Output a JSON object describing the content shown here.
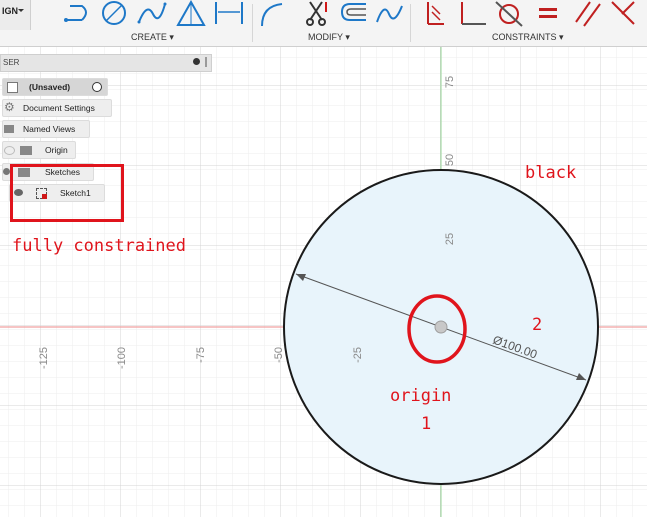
{
  "toolbar": {
    "workspace_label": "IGN",
    "groups": [
      {
        "label": "CREATE ▾"
      },
      {
        "label": "MODIFY ▾"
      },
      {
        "label": "CONSTRAINTS ▾"
      }
    ]
  },
  "browser": {
    "header_label": "SER",
    "root": "(Unsaved)",
    "items": [
      {
        "label": "Document Settings"
      },
      {
        "label": "Named Views"
      },
      {
        "label": "Origin"
      },
      {
        "label": "Sketches"
      },
      {
        "label": "Sketch1"
      }
    ]
  },
  "canvas": {
    "x_ticks": [
      "-125",
      "-100",
      "-75",
      "-50",
      "-25"
    ],
    "y_ticks": [
      "75",
      "50",
      "25"
    ],
    "dimension_label": "Ø100.00",
    "colors": {
      "axis_red": "#f0a0a0",
      "axis_green": "#a8dca8",
      "circle_fill": "#e8f4fb",
      "annotation_red": "#e0141c"
    }
  },
  "annotations": {
    "fully_constrained": "fully constrained",
    "black": "black",
    "origin": "origin",
    "num_1": "1",
    "num_2": "2"
  }
}
